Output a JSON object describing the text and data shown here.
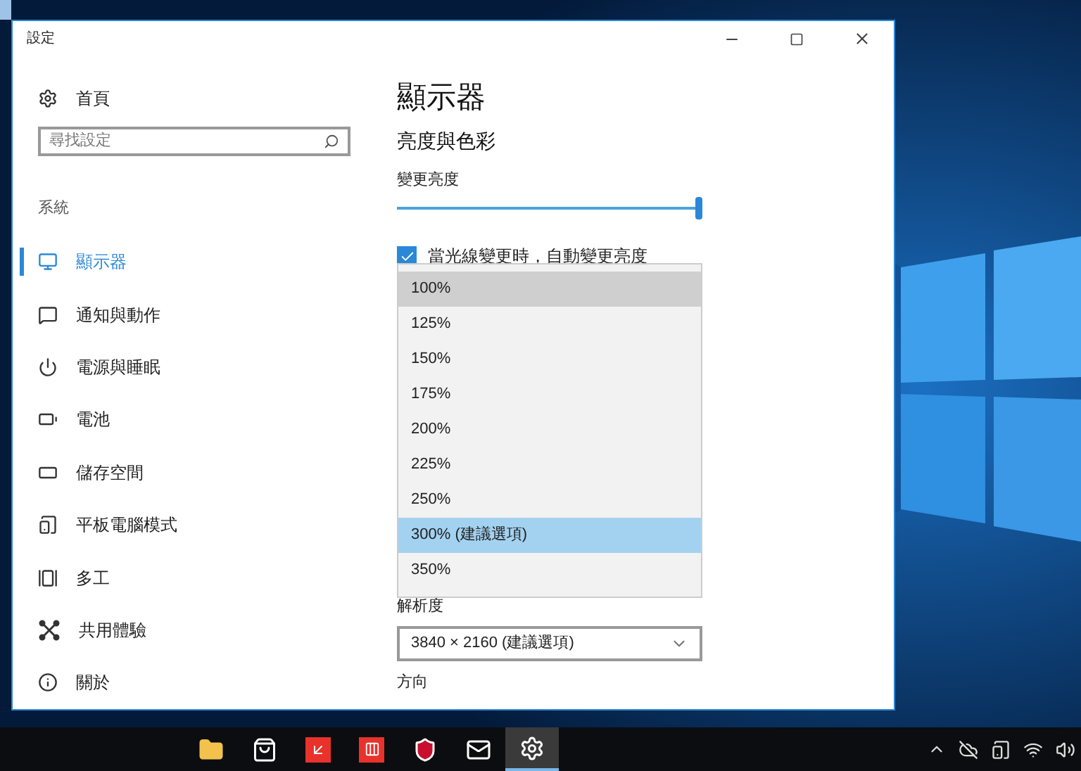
{
  "window": {
    "title": "設定"
  },
  "sidebar": {
    "home": "首頁",
    "search": {
      "placeholder": "尋找設定"
    },
    "section": "系統",
    "items": [
      {
        "label": "顯示器",
        "selected": true
      },
      {
        "label": "通知與動作",
        "selected": false
      },
      {
        "label": "電源與睡眠",
        "selected": false
      },
      {
        "label": "電池",
        "selected": false
      },
      {
        "label": "儲存空間",
        "selected": false
      },
      {
        "label": "平板電腦模式",
        "selected": false
      },
      {
        "label": "多工",
        "selected": false
      },
      {
        "label": "共用體驗",
        "selected": false
      },
      {
        "label": "關於",
        "selected": false
      }
    ]
  },
  "content": {
    "title": "顯示器",
    "section": "亮度與色彩",
    "brightness": {
      "label": "變更亮度",
      "level": 1
    },
    "auto_brightness": {
      "label": "當光線變更時，自動變更亮度",
      "checked": true
    },
    "scale_dropdown": {
      "options": [
        {
          "label": "100%",
          "hovered": true,
          "selected": false
        },
        {
          "label": "125%",
          "hovered": false,
          "selected": false
        },
        {
          "label": "150%",
          "hovered": false,
          "selected": false
        },
        {
          "label": "175%",
          "hovered": false,
          "selected": false
        },
        {
          "label": "200%",
          "hovered": false,
          "selected": false
        },
        {
          "label": "225%",
          "hovered": false,
          "selected": false
        },
        {
          "label": "250%",
          "hovered": false,
          "selected": false
        },
        {
          "label": "300% (建議選項)",
          "hovered": false,
          "selected": true
        },
        {
          "label": "350%",
          "hovered": false,
          "selected": false
        }
      ]
    },
    "resolution": {
      "label": "解析度",
      "value": "3840 × 2160 (建議選項)"
    },
    "orientation": {
      "label": "方向"
    }
  },
  "taskbar": {
    "apps": [
      {
        "kind": "folder",
        "active": false
      },
      {
        "kind": "store",
        "active": false
      },
      {
        "kind": "red-arrow",
        "active": false
      },
      {
        "kind": "red-bars",
        "active": false
      },
      {
        "kind": "shield",
        "active": false
      },
      {
        "kind": "mail",
        "active": false
      },
      {
        "kind": "settings",
        "active": true
      }
    ]
  }
}
